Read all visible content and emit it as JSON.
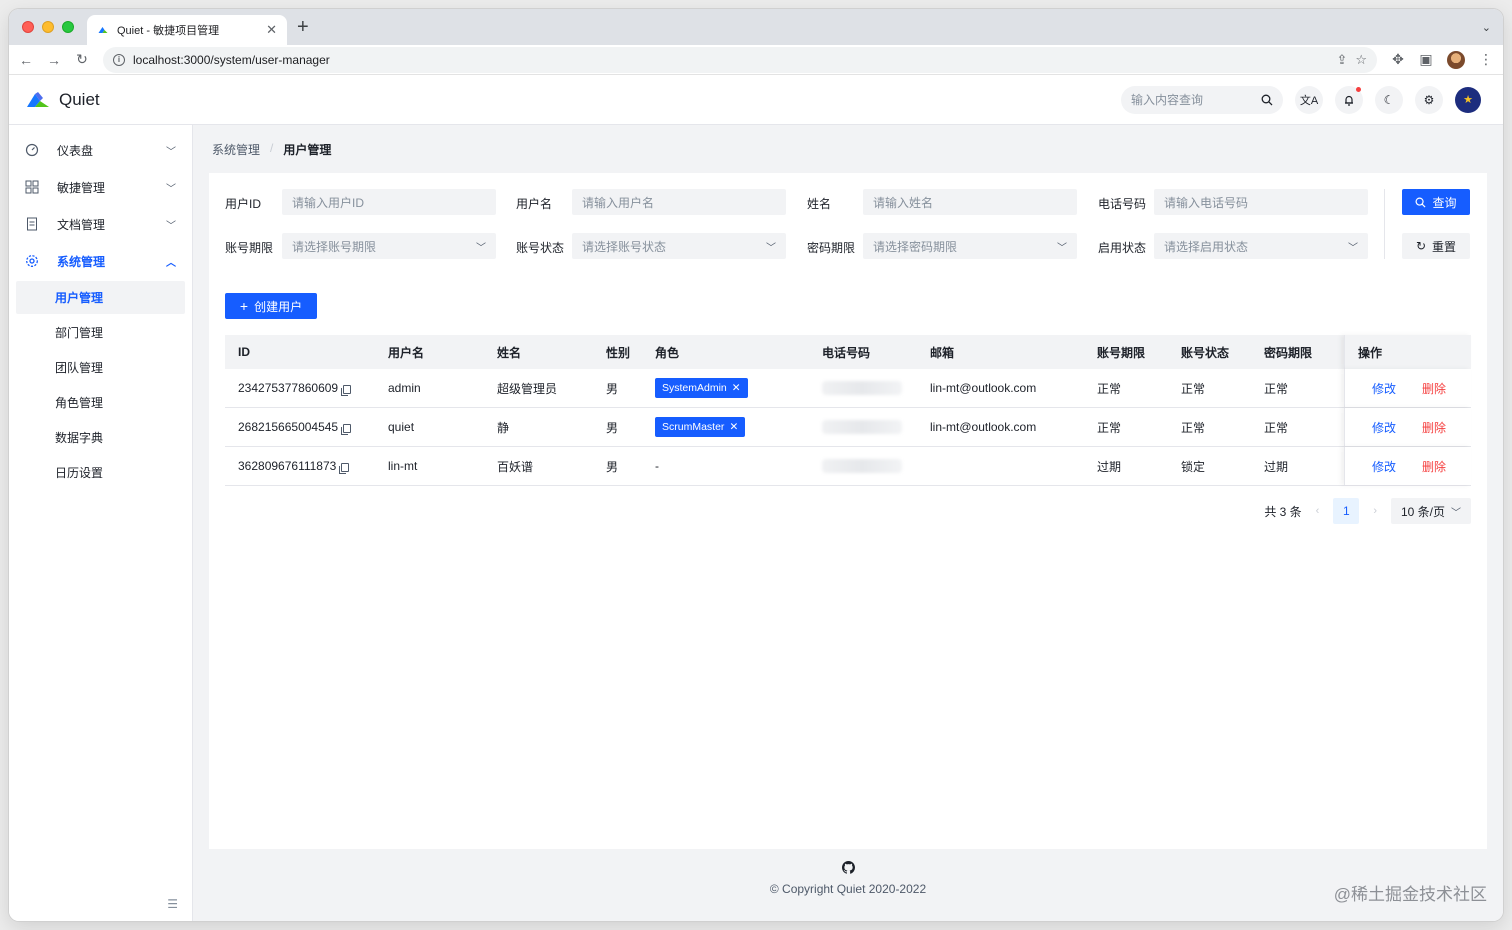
{
  "browser": {
    "tab_title": "Quiet - 敏捷项目管理",
    "url": "localhost:3000/system/user-manager"
  },
  "header": {
    "app_name": "Quiet",
    "search_placeholder": "输入内容查询"
  },
  "sidebar": {
    "items": [
      {
        "label": "仪表盘",
        "icon": "dashboard-icon"
      },
      {
        "label": "敏捷管理",
        "icon": "grid-icon"
      },
      {
        "label": "文档管理",
        "icon": "document-icon"
      },
      {
        "label": "系统管理",
        "icon": "gear-icon"
      }
    ],
    "sub_items": [
      "用户管理",
      "部门管理",
      "团队管理",
      "角色管理",
      "数据字典",
      "日历设置"
    ]
  },
  "breadcrumb": {
    "parent": "系统管理",
    "separator": "/",
    "current": "用户管理"
  },
  "filters": {
    "user_id": {
      "label": "用户ID",
      "placeholder": "请输入用户ID"
    },
    "username": {
      "label": "用户名",
      "placeholder": "请输入用户名"
    },
    "full_name": {
      "label": "姓名",
      "placeholder": "请输入姓名"
    },
    "phone": {
      "label": "电话号码",
      "placeholder": "请输入电话号码"
    },
    "account_expiry": {
      "label": "账号期限",
      "placeholder": "请选择账号期限"
    },
    "account_status": {
      "label": "账号状态",
      "placeholder": "请选择账号状态"
    },
    "password_expiry": {
      "label": "密码期限",
      "placeholder": "请选择密码期限"
    },
    "enabled_status": {
      "label": "启用状态",
      "placeholder": "请选择启用状态"
    },
    "search_button": "查询",
    "reset_button": "重置"
  },
  "create_button": "创建用户",
  "table": {
    "columns": [
      "ID",
      "用户名",
      "姓名",
      "性别",
      "角色",
      "电话号码",
      "邮箱",
      "账号期限",
      "账号状态",
      "密码期限",
      "操作"
    ],
    "rows": [
      {
        "id": "234275377860609",
        "username": "admin",
        "name": "超级管理员",
        "gender": "男",
        "role": "SystemAdmin",
        "email": "lin-mt@outlook.com",
        "account_expiry": "正常",
        "account_status": "正常",
        "password_expiry": "正常",
        "edit": "修改",
        "delete": "删除"
      },
      {
        "id": "268215665004545",
        "username": "quiet",
        "name": "静",
        "gender": "男",
        "role": "ScrumMaster",
        "email": "lin-mt@outlook.com",
        "account_expiry": "正常",
        "account_status": "正常",
        "password_expiry": "正常",
        "edit": "修改",
        "delete": "删除"
      },
      {
        "id": "362809676111873",
        "username": "lin-mt",
        "name": "百妖谱",
        "gender": "男",
        "role": "-",
        "email": "",
        "account_expiry": "过期",
        "account_status": "锁定",
        "password_expiry": "过期",
        "edit": "修改",
        "delete": "删除"
      }
    ]
  },
  "pagination": {
    "total": "共 3 条",
    "current_page": "1",
    "page_size": "10 条/页"
  },
  "footer": {
    "copyright": "© Copyright Quiet 2020-2022"
  },
  "watermark": "@稀土掘金技术社区",
  "colors": {
    "primary": "#165dff",
    "danger": "#f53f3f",
    "background": "#f2f3f5"
  }
}
